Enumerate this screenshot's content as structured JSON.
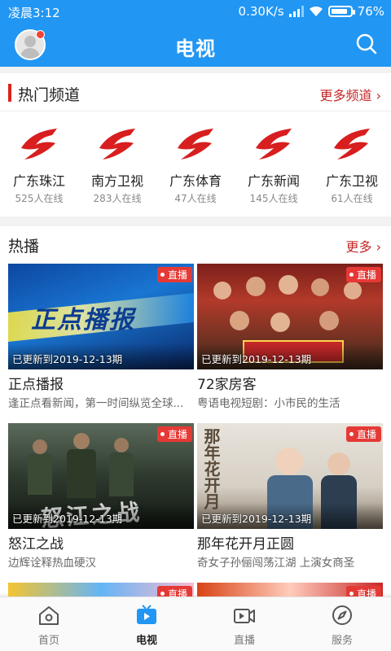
{
  "status": {
    "time": "凌晨3:12",
    "speed": "0.30K/s",
    "battery": "76%"
  },
  "header": {
    "title": "电视"
  },
  "hot_channels": {
    "title": "热门频道",
    "more": "更多频道 ›",
    "items": [
      {
        "name": "广东珠江",
        "online": "525人在线"
      },
      {
        "name": "南方卫视",
        "online": "283人在线"
      },
      {
        "name": "广东体育",
        "online": "47人在线"
      },
      {
        "name": "广东新闻",
        "online": "145人在线"
      },
      {
        "name": "广东卫视",
        "online": "61人在线"
      }
    ]
  },
  "hot_play": {
    "title": "热播",
    "more": "更多 ›",
    "cards": [
      {
        "title": "正点播报",
        "desc": "逢正点看新闻，第一时间纵览全球...",
        "updated": "已更新到2019-12-13期",
        "badge": "直播"
      },
      {
        "title": "72家房客",
        "desc": "粤语电视短剧：小市民的生活",
        "updated": "已更新到2019-12-13期",
        "badge": "直播"
      },
      {
        "title": "怒江之战",
        "desc": "边辉诠释热血硬汉",
        "updated": "已更新到2019-12-13期",
        "badge": "直播"
      },
      {
        "title": "那年花开月正圆",
        "desc": "奇女子孙俪闯荡江湖 上演女商圣",
        "updated": "已更新到2019-12-13期",
        "badge": "直播"
      },
      {
        "badge": "直播"
      },
      {
        "badge": "直播"
      }
    ]
  },
  "tabs": [
    {
      "label": "首页"
    },
    {
      "label": "电视"
    },
    {
      "label": "直播"
    },
    {
      "label": "服务"
    }
  ],
  "colors": {
    "primary": "#2196F3",
    "accent_red": "#d9251c"
  }
}
